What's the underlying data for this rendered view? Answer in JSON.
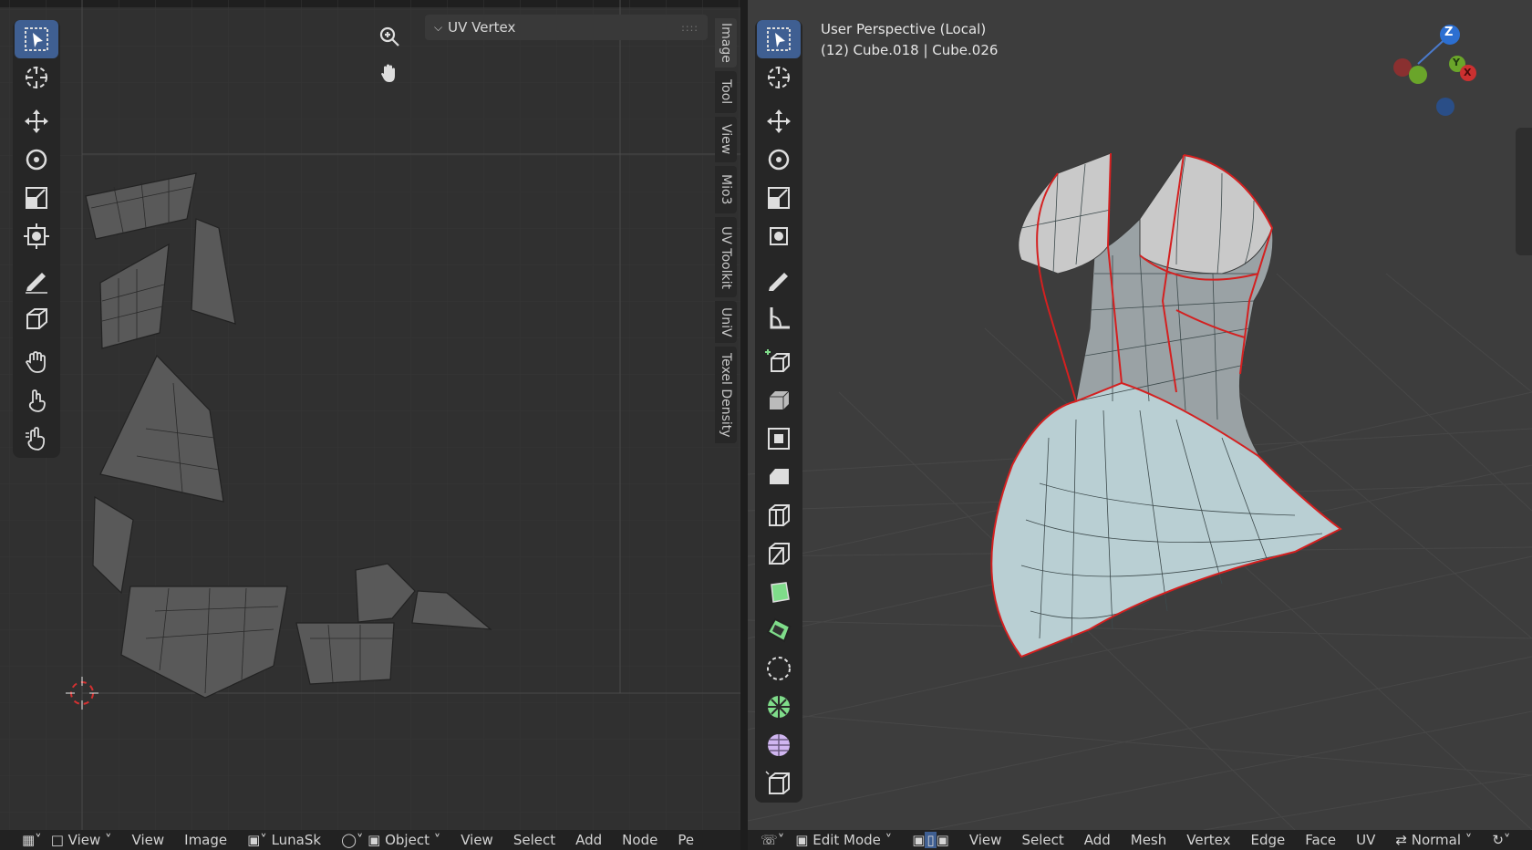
{
  "uv_editor": {
    "panel_title": "UV Vertex",
    "side_tabs": [
      "Image",
      "Tool",
      "View",
      "Mio3",
      "UV Toolkit",
      "UniV",
      "Texel Density"
    ],
    "tools": [
      "select-box",
      "cursor",
      "move",
      "rotate",
      "scale",
      "transform",
      "annotate",
      "grab",
      "pinch",
      "relax",
      "grab-uv"
    ],
    "header": {
      "editor_type": "UV Editor",
      "view_mode": "View",
      "menus": [
        "View",
        "Image"
      ],
      "image_name": "LunaSk",
      "mode": "Object",
      "menus2": [
        "View",
        "Select",
        "Add",
        "Node",
        "Pe"
      ]
    }
  },
  "viewport": {
    "perspective": "User Perspective (Local)",
    "object_info": "(12) Cube.018 | Cube.026",
    "gizmo_axes": [
      "Z",
      "Y",
      "X"
    ],
    "header": {
      "mode": "Edit Mode",
      "menus": [
        "View",
        "Select",
        "Add",
        "Mesh",
        "Vertex",
        "Edge",
        "Face",
        "UV"
      ],
      "orientation": "Normal"
    },
    "colors": {
      "seam": "#d42020",
      "mesh_face": "#b9cfd3",
      "selected": "#3f5f92"
    }
  }
}
